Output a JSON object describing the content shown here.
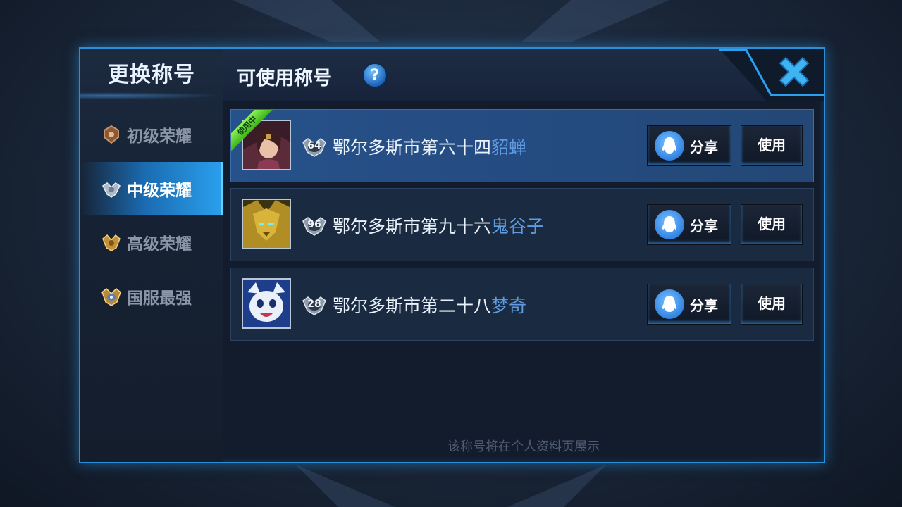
{
  "sidebar": {
    "title": "更换称号",
    "items": [
      {
        "label": "初级荣耀",
        "active": false
      },
      {
        "label": "中级荣耀",
        "active": true
      },
      {
        "label": "高级荣耀",
        "active": false
      },
      {
        "label": "国服最强",
        "active": false
      }
    ]
  },
  "header": {
    "title": "可使用称号",
    "help_label": "?"
  },
  "titles": [
    {
      "in_use_label": "使用中",
      "level": "64",
      "prefix": "鄂尔多斯市第六十四",
      "hero": "貂蝉",
      "share_label": "分享",
      "use_label": "使用"
    },
    {
      "level": "96",
      "prefix": "鄂尔多斯市第九十六",
      "hero": "鬼谷子",
      "share_label": "分享",
      "use_label": "使用"
    },
    {
      "level": "28",
      "prefix": "鄂尔多斯市第二十八",
      "hero": "梦奇",
      "share_label": "分享",
      "use_label": "使用"
    }
  ],
  "footer": {
    "note": "该称号将在个人资料页展示"
  },
  "colors": {
    "accent": "#2aa0ee",
    "hero_name": "#5f9be0",
    "in_use_badge": "#4ac41f"
  }
}
